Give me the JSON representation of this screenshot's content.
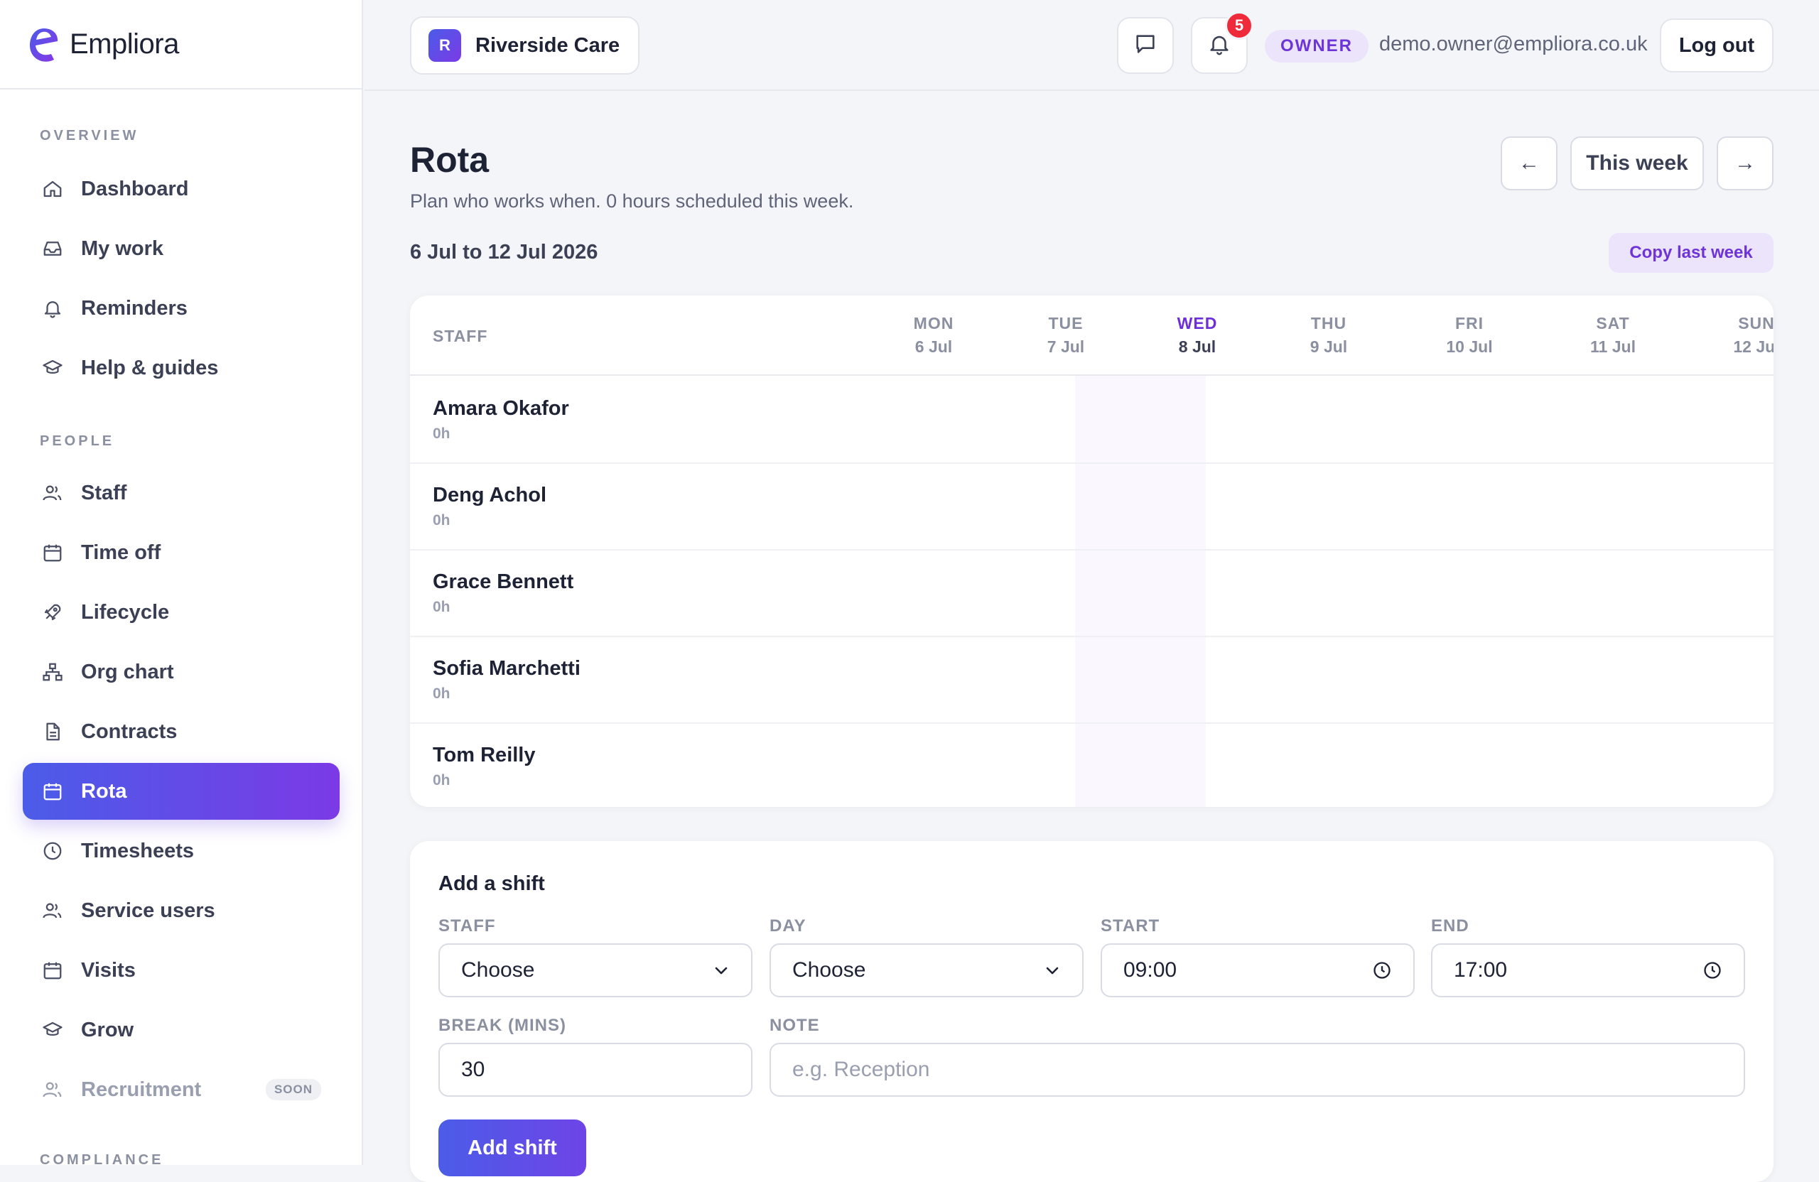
{
  "brand": {
    "name": "Empliora"
  },
  "sidebar": {
    "sections": [
      {
        "label": "OVERVIEW"
      },
      {
        "label": "PEOPLE"
      },
      {
        "label": "COMPLIANCE"
      }
    ],
    "items": [
      {
        "label": "Dashboard",
        "icon": "home-icon"
      },
      {
        "label": "My work",
        "icon": "inbox-icon"
      },
      {
        "label": "Reminders",
        "icon": "bell-icon"
      },
      {
        "label": "Help & guides",
        "icon": "graduation-cap-icon"
      },
      {
        "label": "Staff",
        "icon": "users-icon"
      },
      {
        "label": "Time off",
        "icon": "calendar-icon"
      },
      {
        "label": "Lifecycle",
        "icon": "rocket-icon"
      },
      {
        "label": "Org chart",
        "icon": "org-chart-icon"
      },
      {
        "label": "Contracts",
        "icon": "document-icon"
      },
      {
        "label": "Rota",
        "icon": "calendar-icon",
        "active": true
      },
      {
        "label": "Timesheets",
        "icon": "clock-icon"
      },
      {
        "label": "Service users",
        "icon": "users-icon"
      },
      {
        "label": "Visits",
        "icon": "calendar-icon"
      },
      {
        "label": "Grow",
        "icon": "graduation-cap-icon"
      },
      {
        "label": "Recruitment",
        "icon": "users-icon",
        "badge": "SOON"
      }
    ]
  },
  "topbar": {
    "org_initial": "R",
    "org_name": "Riverside Care",
    "notifications_count": "5",
    "role": "OWNER",
    "email": "demo.owner@empliora.co.uk",
    "logout_label": "Log out"
  },
  "page": {
    "title": "Rota",
    "subtitle": "Plan who works when. 0 hours scheduled this week.",
    "date_range": "6 Jul to 12 Jul 2026",
    "prev_label": "←",
    "this_week_label": "This week",
    "next_label": "→",
    "copy_label": "Copy last week"
  },
  "rota": {
    "staff_header": "STAFF",
    "days": [
      {
        "name": "MON",
        "date": "6 Jul"
      },
      {
        "name": "TUE",
        "date": "7 Jul"
      },
      {
        "name": "WED",
        "date": "8 Jul",
        "today": true
      },
      {
        "name": "THU",
        "date": "9 Jul"
      },
      {
        "name": "FRI",
        "date": "10 Jul"
      },
      {
        "name": "SAT",
        "date": "11 Jul"
      },
      {
        "name": "SUN",
        "date": "12 Jul"
      }
    ],
    "rows": [
      {
        "name": "Amara Okafor",
        "hours": "0h"
      },
      {
        "name": "Deng Achol",
        "hours": "0h"
      },
      {
        "name": "Grace Bennett",
        "hours": "0h"
      },
      {
        "name": "Sofia Marchetti",
        "hours": "0h"
      },
      {
        "name": "Tom Reilly",
        "hours": "0h"
      }
    ]
  },
  "shift_form": {
    "title": "Add a shift",
    "staff_label": "STAFF",
    "staff_value": "Choose",
    "day_label": "DAY",
    "day_value": "Choose",
    "start_label": "START",
    "start_value": "09:00",
    "end_label": "END",
    "end_value": "17:00",
    "break_label": "BREAK (MINS)",
    "break_value": "30",
    "note_label": "NOTE",
    "note_placeholder": "e.g. Reception",
    "submit_label": "Add shift"
  },
  "colors": {
    "accent_start": "#4b5ce8",
    "accent_end": "#7b3ae6",
    "role_pill_bg": "#ece4fb",
    "notification": "#ef2b3b",
    "today_highlight": "#faf7fe"
  }
}
